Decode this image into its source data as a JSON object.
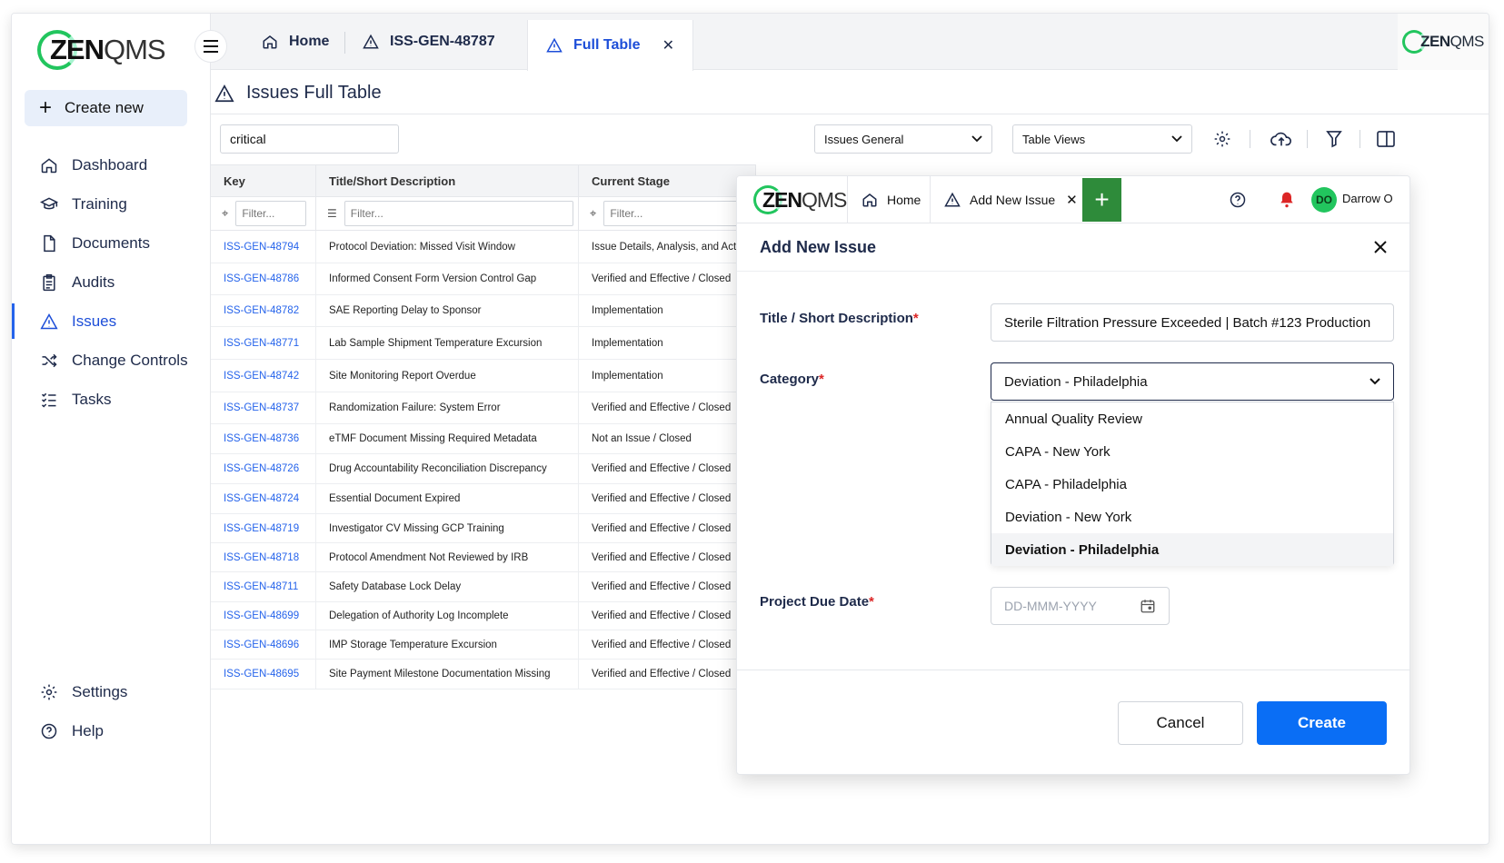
{
  "brand": {
    "logo_bold": "ZEN",
    "logo_light": "QMS",
    "accent": "#22c55e",
    "primary": "#0a6ef5"
  },
  "sidebar": {
    "create_label": "Create new",
    "items": [
      {
        "label": "Dashboard",
        "icon": "home-icon"
      },
      {
        "label": "Training",
        "icon": "graduation-cap-icon"
      },
      {
        "label": "Documents",
        "icon": "document-icon"
      },
      {
        "label": "Audits",
        "icon": "clipboard-icon"
      },
      {
        "label": "Issues",
        "icon": "warning-icon",
        "active": true
      },
      {
        "label": "Change Controls",
        "icon": "shuffle-icon"
      },
      {
        "label": "Tasks",
        "icon": "checklist-icon"
      }
    ],
    "bottom": [
      {
        "label": "Settings",
        "icon": "gear-icon"
      },
      {
        "label": "Help",
        "icon": "help-icon"
      }
    ]
  },
  "tabs": [
    {
      "label": "Home"
    },
    {
      "label": "ISS-GEN-48787"
    },
    {
      "label": "Full Table"
    }
  ],
  "page": {
    "title": "Issues Full Table",
    "search_value": "critical",
    "view_select": "Issues General",
    "table_views": "Table Views"
  },
  "table": {
    "headers": [
      "Key",
      "Title/Short Description",
      "Current Stage"
    ],
    "filter_placeholder": "Filter...",
    "rows": [
      [
        "ISS-GEN-48794",
        "Protocol Deviation: Missed Visit Window",
        "Issue Details, Analysis, and Action Pla"
      ],
      [
        "ISS-GEN-48786",
        "Informed Consent Form Version Control Gap",
        "Verified and Effective / Closed"
      ],
      [
        "ISS-GEN-48782",
        "SAE Reporting Delay to Sponsor",
        "Implementation"
      ],
      [
        "ISS-GEN-48771",
        "Lab Sample Shipment Temperature Excursion",
        "Implementation"
      ],
      [
        "ISS-GEN-48742",
        "Site Monitoring Report Overdue",
        "Implementation"
      ],
      [
        "ISS-GEN-48737",
        "Randomization Failure: System Error",
        "Verified and Effective / Closed"
      ],
      [
        "ISS-GEN-48736",
        "eTMF Document Missing Required Metadata",
        "Not an Issue / Closed"
      ],
      [
        "ISS-GEN-48726",
        "Drug Accountability Reconciliation Discrepancy",
        "Verified and Effective / Closed"
      ],
      [
        "ISS-GEN-48724",
        "Essential Document Expired",
        "Verified and Effective / Closed"
      ],
      [
        "ISS-GEN-48719",
        "Investigator CV Missing GCP Training",
        "Verified and Effective / Closed"
      ],
      [
        "ISS-GEN-48718",
        "Protocol Amendment Not Reviewed by IRB",
        "Verified and Effective / Closed"
      ],
      [
        "ISS-GEN-48711",
        "Safety Database Lock Delay",
        "Verified and Effective / Closed"
      ],
      [
        "ISS-GEN-48699",
        "Delegation of Authority Log Incomplete",
        "Verified and Effective / Closed"
      ],
      [
        "ISS-GEN-48696",
        "IMP Storage Temperature Excursion",
        "Verified and Effective / Closed"
      ],
      [
        "ISS-GEN-48695",
        "Site Payment Milestone Documentation Missing",
        "Verified and Effective / Closed"
      ]
    ]
  },
  "modal": {
    "tabs": {
      "home": "Home",
      "add": "Add New Issue"
    },
    "user_initials": "DO",
    "user_name": "Darrow O",
    "title": "Add New Issue",
    "title_label": "Title / Short Description",
    "title_value": "Sterile Filtration Pressure Exceeded | Batch #123 Production",
    "category_label": "Category",
    "category_value": "Deviation - Philadelphia",
    "category_options": [
      "Annual Quality Review",
      "CAPA - New York",
      "CAPA - Philadelphia",
      "Deviation - New York",
      "Deviation - Philadelphia"
    ],
    "due_label": "Project Due Date",
    "due_placeholder": "DD-MMM-YYYY",
    "cancel": "Cancel",
    "create": "Create",
    "required_mark": "*"
  }
}
